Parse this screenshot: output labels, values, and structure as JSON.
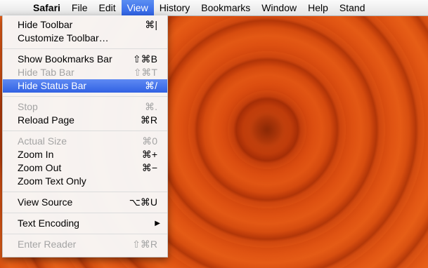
{
  "menubar": {
    "apple_icon": "apple-logo-icon",
    "items": [
      {
        "label": "Safari"
      },
      {
        "label": "File"
      },
      {
        "label": "Edit"
      },
      {
        "label": "View"
      },
      {
        "label": "History"
      },
      {
        "label": "Bookmarks"
      },
      {
        "label": "Window"
      },
      {
        "label": "Help"
      },
      {
        "label": "Stand"
      }
    ],
    "active_index": 3
  },
  "view_menu": {
    "groups": [
      [
        {
          "label": "Hide Toolbar",
          "shortcut": "⌘|",
          "enabled": true
        },
        {
          "label": "Customize Toolbar…",
          "shortcut": "",
          "enabled": true
        }
      ],
      [
        {
          "label": "Show Bookmarks Bar",
          "shortcut": "⇧⌘B",
          "enabled": true
        },
        {
          "label": "Hide Tab Bar",
          "shortcut": "⇧⌘T",
          "enabled": false
        },
        {
          "label": "Hide Status Bar",
          "shortcut": "⌘/",
          "enabled": true,
          "selected": true
        }
      ],
      [
        {
          "label": "Stop",
          "shortcut": "⌘.",
          "enabled": false
        },
        {
          "label": "Reload Page",
          "shortcut": "⌘R",
          "enabled": true
        }
      ],
      [
        {
          "label": "Actual Size",
          "shortcut": "⌘0",
          "enabled": false
        },
        {
          "label": "Zoom In",
          "shortcut": "⌘+",
          "enabled": true
        },
        {
          "label": "Zoom Out",
          "shortcut": "⌘−",
          "enabled": true
        },
        {
          "label": "Zoom Text Only",
          "shortcut": "",
          "enabled": true
        }
      ],
      [
        {
          "label": "View Source",
          "shortcut": "⌥⌘U",
          "enabled": true
        }
      ],
      [
        {
          "label": "Text Encoding",
          "shortcut": "",
          "enabled": true,
          "submenu": true
        }
      ],
      [
        {
          "label": "Enter Reader",
          "shortcut": "⇧⌘R",
          "enabled": false
        }
      ]
    ]
  },
  "colors": {
    "highlight": "#3a6ce6",
    "disabled_text": "#a4a4a4",
    "wallpaper": "#e8863a"
  }
}
